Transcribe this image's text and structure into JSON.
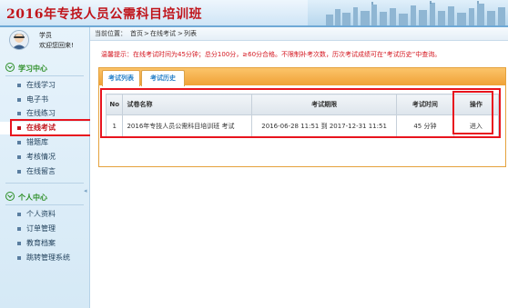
{
  "header": {
    "title": "2016年专技人员公需科目培训班"
  },
  "user": {
    "role": "学员",
    "welcome": "欢迎您回来!"
  },
  "learning_center": {
    "title": "学习中心",
    "items": [
      {
        "label": "在线学习"
      },
      {
        "label": "电子书"
      },
      {
        "label": "在线练习"
      },
      {
        "label": "在线考试"
      },
      {
        "label": "错题库"
      },
      {
        "label": "考核情况"
      },
      {
        "label": "在线留言"
      }
    ]
  },
  "personal_center": {
    "title": "个人中心",
    "items": [
      {
        "label": "个人资料"
      },
      {
        "label": "订单管理"
      },
      {
        "label": "教育档案"
      },
      {
        "label": "跳转管理系统"
      }
    ]
  },
  "breadcrumb": {
    "prefix": "当前位置：",
    "home": "首页",
    "sep1": ">",
    "section": "在线考试",
    "sep2": ">",
    "current": "列表"
  },
  "notice": "温馨提示：在线考试时间为45分钟；总分100分，≥60分合格。不限制补考次数，历次考试成绩可在“考试历史”中查询。",
  "tabs": [
    {
      "label": "考试列表"
    },
    {
      "label": "考试历史"
    }
  ],
  "table": {
    "headers": {
      "no": "No",
      "name": "试卷名称",
      "period": "考试期限",
      "time": "考试时间",
      "op": "操作"
    },
    "rows": [
      {
        "no": "1",
        "name": "2016年专技人员公需科目培训班 考试",
        "period": "2016-06-28 11:51 到 2017-12-31 11:51",
        "time": "45 分钟",
        "op": "进入"
      }
    ]
  },
  "colors": {
    "title_red": "#c0141b",
    "green": "#2b8e25",
    "notice_red": "#d4161f",
    "tab_orange": "#f0a136",
    "highlight": "#e8141e"
  }
}
